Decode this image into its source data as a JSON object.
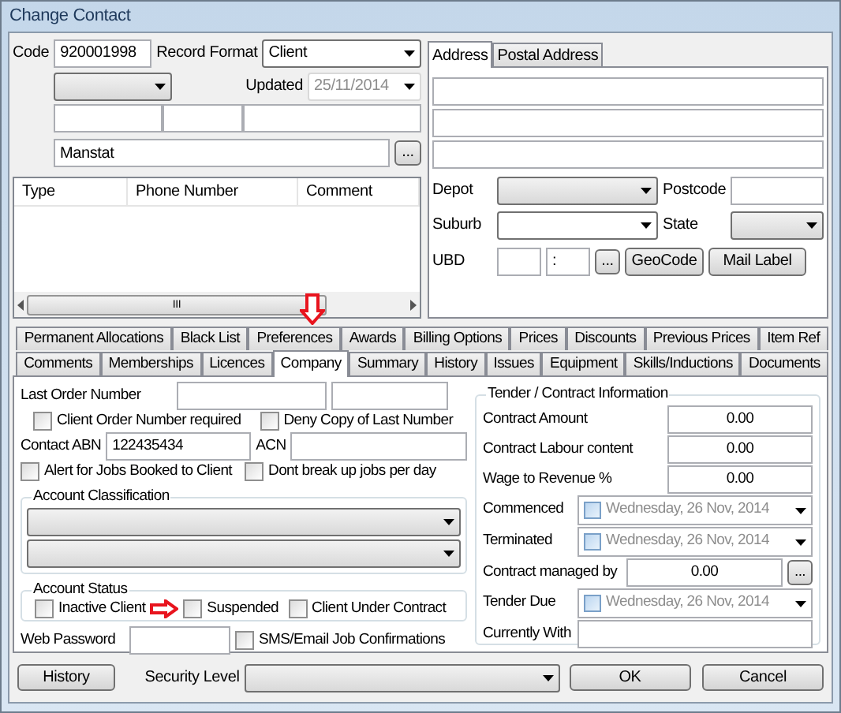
{
  "window": {
    "title": "Change Contact"
  },
  "header": {
    "code_label": "Code",
    "code": "920001998",
    "record_format_label": "Record Format",
    "record_format": "Client",
    "updated_label": "Updated",
    "updated": "25/11/2014",
    "name": "Manstat",
    "browse_button": "..."
  },
  "phone_table": {
    "columns": [
      "Type",
      "Phone Number",
      "Comment"
    ],
    "scroll_grip": "III"
  },
  "address_tabs": [
    {
      "label": "Address",
      "selected": true
    },
    {
      "label": "Postal Address",
      "selected": false
    }
  ],
  "address": {
    "depot_label": "Depot",
    "postcode_label": "Postcode",
    "suburb_label": "Suburb",
    "state_label": "State",
    "ubd_label": "UBD",
    "ubd_value": ":",
    "browse_button": "...",
    "geocode_button": "GeoCode",
    "mail_label_button": "Mail Label"
  },
  "tab_rows": [
    [
      {
        "label": "Permanent Allocations",
        "selected": false
      },
      {
        "label": "Black List",
        "selected": false
      },
      {
        "label": "Preferences",
        "selected": false
      },
      {
        "label": "Awards",
        "selected": false
      },
      {
        "label": "Billing Options",
        "selected": false
      },
      {
        "label": "Prices",
        "selected": false
      },
      {
        "label": "Discounts",
        "selected": false
      },
      {
        "label": "Previous Prices",
        "selected": false
      },
      {
        "label": "Item Ref",
        "selected": false
      }
    ],
    [
      {
        "label": "Comments",
        "selected": false
      },
      {
        "label": "Memberships",
        "selected": false
      },
      {
        "label": "Licences",
        "selected": false
      },
      {
        "label": "Company",
        "selected": true
      },
      {
        "label": "Summary",
        "selected": false
      },
      {
        "label": "History",
        "selected": false
      },
      {
        "label": "Issues",
        "selected": false
      },
      {
        "label": "Equipment",
        "selected": false
      },
      {
        "label": "Skills/Inductions",
        "selected": false
      },
      {
        "label": "Documents",
        "selected": false
      }
    ]
  ],
  "company": {
    "last_order_label": "Last Order Number",
    "order_checks": [
      {
        "label": "Client Order Number required",
        "checked": false
      },
      {
        "label": "Deny Copy of Last Number",
        "checked": false
      }
    ],
    "abn_label": "Contact ABN",
    "abn": "122435434",
    "acn_label": "ACN",
    "job_checks": [
      {
        "label": "Alert for Jobs Booked to Client",
        "checked": false
      },
      {
        "label": "Dont break up jobs per day",
        "checked": false
      }
    ],
    "classification_title": "Account Classification",
    "status_title": "Account Status",
    "status_checks": [
      {
        "label": "Inactive Client",
        "checked": false
      },
      {
        "label": "Suspended",
        "checked": false
      },
      {
        "label": "Client Under Contract",
        "checked": false
      }
    ],
    "web_password_label": "Web Password",
    "sms_check": {
      "label": "SMS/Email Job Confirmations",
      "checked": false
    },
    "tender_title": "Tender / Contract Information",
    "tender_rows": [
      {
        "kind": "amount",
        "label": "Contract Amount",
        "value": "0.00"
      },
      {
        "kind": "amount",
        "label": "Contract Labour content",
        "value": "0.00"
      },
      {
        "kind": "amount",
        "label": "Wage to Revenue %",
        "value": "0.00"
      },
      {
        "kind": "date",
        "label": "Commenced",
        "value": "Wednesday, 26 Nov, 2014",
        "checked": false
      },
      {
        "kind": "date",
        "label": "Terminated",
        "value": "Wednesday, 26 Nov, 2014",
        "checked": false
      },
      {
        "kind": "lookup",
        "label": "Contract managed by",
        "value": "0.00",
        "button": "..."
      },
      {
        "kind": "date",
        "label": "Tender Due",
        "value": "Wednesday, 26 Nov, 2014",
        "checked": false
      },
      {
        "kind": "text",
        "label": "Currently With"
      }
    ]
  },
  "footer": {
    "history_button": "History",
    "security_label": "Security Level",
    "ok_button": "OK",
    "cancel_button": "Cancel"
  }
}
